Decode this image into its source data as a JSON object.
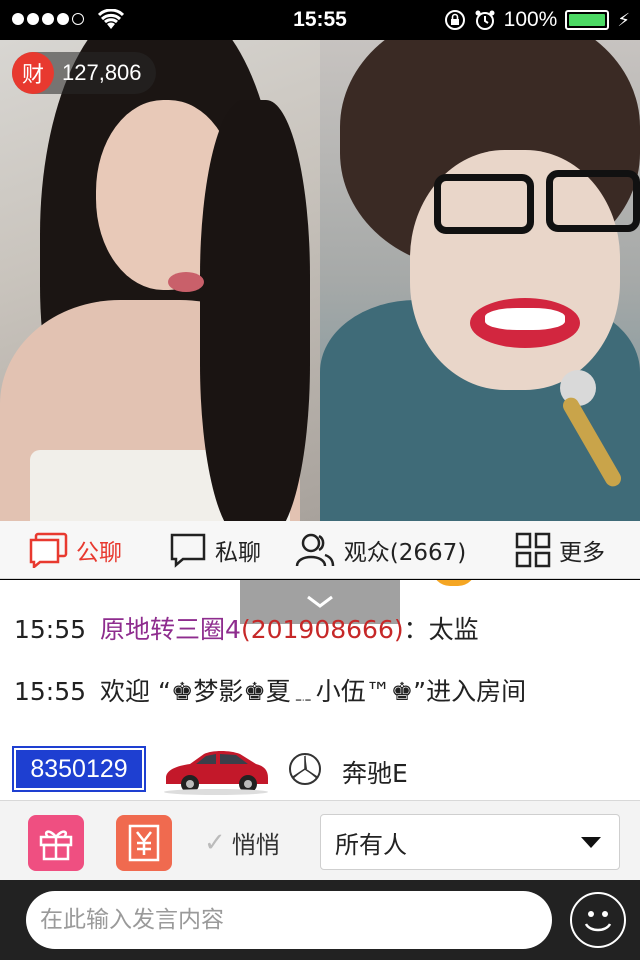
{
  "status_bar": {
    "time": "15:55",
    "battery": "100%",
    "signal_bars_filled": 4,
    "signal_bars_total": 5
  },
  "video": {
    "wealth_icon_label": "财",
    "wealth_count": "127,806"
  },
  "tabs": [
    {
      "label": "公聊",
      "icon": "chat-bubble-icon",
      "active": true
    },
    {
      "label": "私聊",
      "icon": "private-chat-icon",
      "active": false
    },
    {
      "label": "观众(2667)",
      "icon": "audience-icon",
      "active": false
    },
    {
      "label": "更多",
      "icon": "grid-icon",
      "active": false
    }
  ],
  "chat": {
    "messages": [
      {
        "time": "15:55",
        "name": "原地转三圈4",
        "uid": "(201908666)",
        "separator": "：",
        "text": "太监"
      },
      {
        "time": "15:55",
        "text": "欢迎 “♚梦影♚夏﹎小伍™♚”进入房间"
      }
    ],
    "car": {
      "id": "8350129",
      "icon": "mercedes-logo-icon",
      "name": "奔驰E"
    }
  },
  "toolbar": {
    "gift_icon": "gift-icon",
    "yuan_icon": "yuan-icon",
    "whisper_label": "悄悄",
    "target_value": "所有人"
  },
  "input": {
    "placeholder": "在此输入发言内容",
    "emoji_icon": "smiley-icon"
  },
  "colors": {
    "accent": "#e8392f",
    "battery": "#4cd964",
    "car_id_bg": "#1e3fd1",
    "gift": "#ef4f81",
    "yuan": "#f06a4f"
  }
}
